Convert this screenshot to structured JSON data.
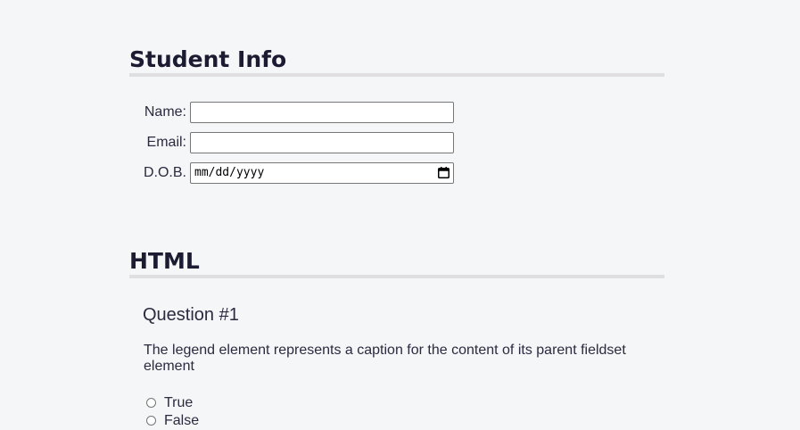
{
  "student_info": {
    "title": "Student Info",
    "fields": [
      {
        "label": "Name:",
        "value": ""
      },
      {
        "label": "Email:",
        "value": ""
      },
      {
        "label": "D.O.B.",
        "value": "mm/dd/yyyy"
      }
    ]
  },
  "html_section": {
    "title": "HTML",
    "question": {
      "title": "Question #1",
      "text": "The legend element represents a caption for the content of its parent fieldset element",
      "options": [
        "True",
        "False"
      ]
    }
  },
  "icons": {
    "calendar": "calendar-icon"
  },
  "colors": {
    "background": "#f5f6f7",
    "text": "#1b1b32",
    "rule": "#dfdfe2"
  }
}
